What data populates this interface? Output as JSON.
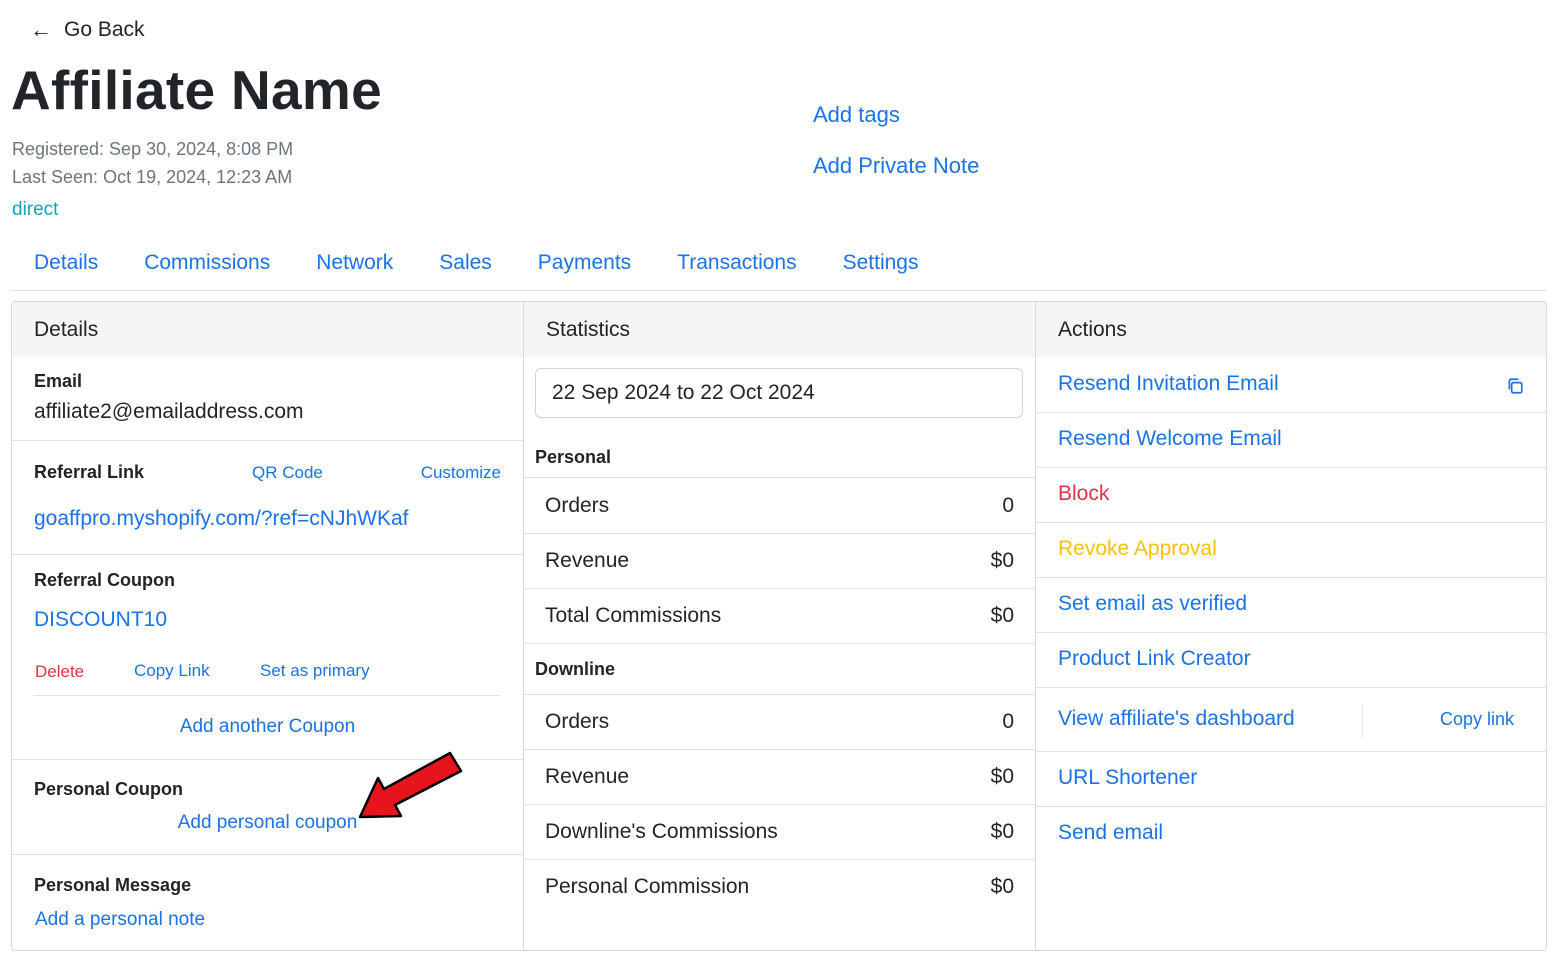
{
  "header": {
    "back_label": "Go Back",
    "title": "Affiliate Name",
    "registered": "Registered: Sep 30, 2024, 8:08 PM",
    "last_seen": "Last Seen: Oct 19, 2024, 12:23 AM",
    "source": "direct",
    "add_tags": "Add tags",
    "add_private_note": "Add Private Note"
  },
  "tabs": [
    "Details",
    "Commissions",
    "Network",
    "Sales",
    "Payments",
    "Transactions",
    "Settings"
  ],
  "details": {
    "heading": "Details",
    "email_label": "Email",
    "email_value": "affiliate2@emailaddress.com",
    "referral_link_label": "Referral Link",
    "qr_code": "QR Code",
    "customize": "Customize",
    "referral_link_value": "goaffpro.myshopify.com/?ref=cNJhWKaf",
    "referral_coupon_label": "Referral Coupon",
    "coupon_code": "DISCOUNT10",
    "delete": "Delete",
    "copy_link": "Copy Link",
    "set_primary": "Set as primary",
    "add_another_coupon": "Add another Coupon",
    "personal_coupon_label": "Personal Coupon",
    "add_personal_coupon": "Add personal coupon",
    "personal_message_label": "Personal Message",
    "add_personal_note": "Add a personal note"
  },
  "statistics": {
    "heading": "Statistics",
    "date_range": "22 Sep 2024 to 22 Oct 2024",
    "personal_heading": "Personal",
    "personal_rows": [
      {
        "label": "Orders",
        "value": "0"
      },
      {
        "label": "Revenue",
        "value": "$0"
      },
      {
        "label": "Total Commissions",
        "value": "$0"
      }
    ],
    "downline_heading": "Downline",
    "downline_rows": [
      {
        "label": "Orders",
        "value": "0"
      },
      {
        "label": "Revenue",
        "value": "$0"
      },
      {
        "label": "Downline's Commissions",
        "value": "$0"
      },
      {
        "label": "Personal Commission",
        "value": "$0"
      }
    ]
  },
  "actions": {
    "heading": "Actions",
    "items": [
      "Resend Invitation Email",
      "Resend Welcome Email",
      "Block",
      "Revoke Approval",
      "Set email as verified",
      "Product Link Creator",
      "View affiliate's dashboard",
      "URL Shortener",
      "Send email"
    ],
    "copy_link": "Copy link"
  },
  "colors": {
    "link": "#1a73e8",
    "danger": "#dc3545",
    "warning": "#ffc107",
    "info": "#17a2b8",
    "annotation_arrow": "#e8141c"
  },
  "icons": {
    "back": "arrow-left-icon",
    "copy": "copy-icon",
    "annotation": "red-arrow-annotation"
  }
}
